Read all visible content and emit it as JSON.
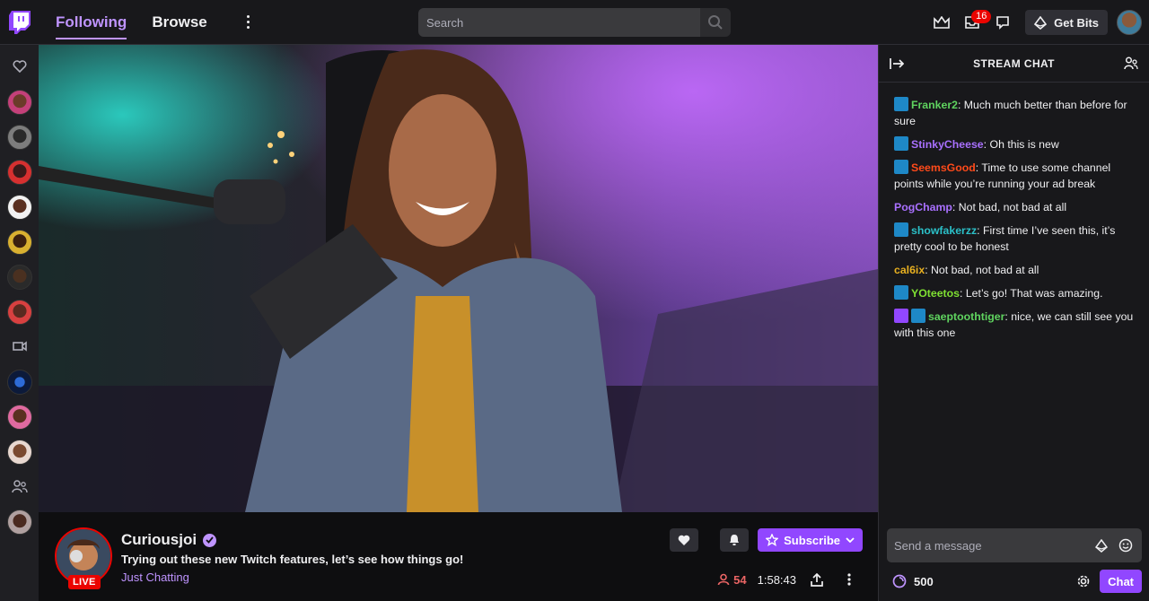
{
  "nav": {
    "following_label": "Following",
    "browse_label": "Browse",
    "search_placeholder": "Search",
    "notifications_count": "16",
    "get_bits_label": "Get Bits"
  },
  "stream": {
    "streamer_name": "Curiousjoi",
    "title": "Trying out these new Twitch features, let’s see how things go!",
    "category": "Just Chatting",
    "live_label": "LIVE",
    "viewers": "54",
    "uptime": "1:58:43",
    "subscribe_label": "Subscribe"
  },
  "chat": {
    "header": "STREAM CHAT",
    "input_placeholder": "Send a message",
    "points": "500",
    "chat_button": "Chat",
    "messages": [
      {
        "user": "Franker2",
        "color": "#5fd35f",
        "text": "Much much better than before for sure",
        "badges": [
          "crown"
        ]
      },
      {
        "user": "StinkyCheese",
        "color": "#a970ff",
        "text": "Oh this is new",
        "badges": [
          "crown"
        ]
      },
      {
        "user": "SeemsGood",
        "color": "#ff4a1a",
        "text": "Time to use some channel points while you’re running your ad break",
        "badges": [
          "crown"
        ]
      },
      {
        "user": "PogChamp",
        "color": "#a970ff",
        "text": "Not bad, not bad at all",
        "badges": []
      },
      {
        "user": "showfakerzz",
        "color": "#2bc0c8",
        "text": "First time I’ve seen this, it’s pretty cool to be honest",
        "badges": [
          "crown"
        ]
      },
      {
        "user": "cal6ix",
        "color": "#e8b020",
        "text": "Not bad, not bad at all",
        "badges": []
      },
      {
        "user": "YOteetos",
        "color": "#7fe032",
        "text": "Let’s go! That was amazing.",
        "badges": [
          "crown"
        ]
      },
      {
        "user": "saeptoothtiger",
        "color": "#5fd35f",
        "text": "nice, we can still see you with this one",
        "badges": [
          "star",
          "crown"
        ]
      }
    ]
  },
  "colors": {
    "accent": "#9147ff",
    "accent_text": "#bf94ff",
    "live_red": "#eb0400",
    "background": "#0e0e10",
    "panel": "#18181b"
  }
}
